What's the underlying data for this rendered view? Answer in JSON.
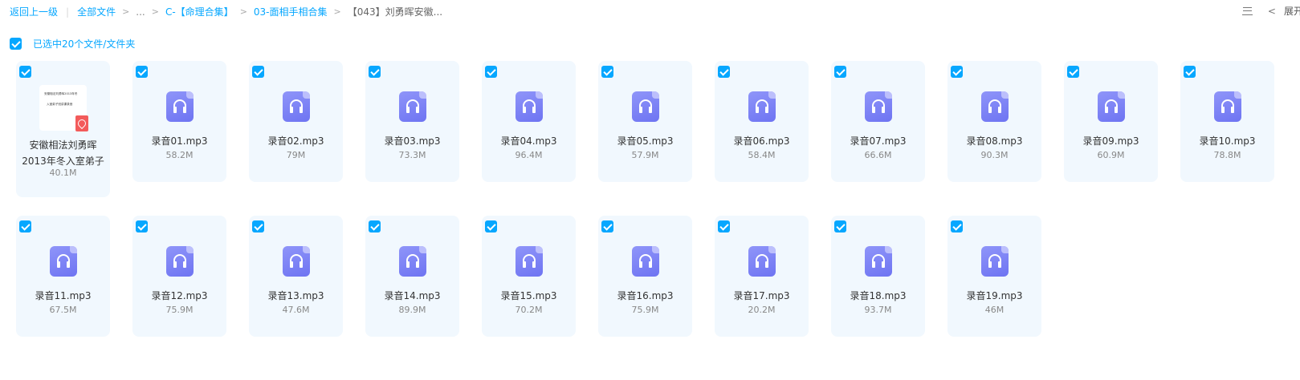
{
  "breadcrumb": {
    "back": "返回上一级",
    "items": [
      "全部文件",
      "...",
      "C-【命理合集】",
      "03-面相手相合集",
      "【043】刘勇晖安徽..."
    ],
    "separator": ">"
  },
  "toolbar": {
    "expand_label": "展开",
    "back_chevron": "<"
  },
  "selection": {
    "label": "已选中20个文件/文件夹"
  },
  "pdf_file": {
    "name": "安徽相法刘勇晖2013年冬入室弟子",
    "size": "40.1M",
    "thumb_line1": "安徽相法刘勇晖2013年冬",
    "thumb_line2": "入室弟子班讲课录音"
  },
  "files_row1": [
    {
      "name": "录音01.mp3",
      "size": "58.2M"
    },
    {
      "name": "录音02.mp3",
      "size": "79M"
    },
    {
      "name": "录音03.mp3",
      "size": "73.3M"
    },
    {
      "name": "录音04.mp3",
      "size": "96.4M"
    },
    {
      "name": "录音05.mp3",
      "size": "57.9M"
    },
    {
      "name": "录音06.mp3",
      "size": "58.4M"
    },
    {
      "name": "录音07.mp3",
      "size": "66.6M"
    },
    {
      "name": "录音08.mp3",
      "size": "90.3M"
    },
    {
      "name": "录音09.mp3",
      "size": "60.9M"
    },
    {
      "name": "录音10.mp3",
      "size": "78.8M"
    }
  ],
  "files_row2": [
    {
      "name": "录音11.mp3",
      "size": "67.5M"
    },
    {
      "name": "录音12.mp3",
      "size": "75.9M"
    },
    {
      "name": "录音13.mp3",
      "size": "47.6M"
    },
    {
      "name": "录音14.mp3",
      "size": "89.9M"
    },
    {
      "name": "录音15.mp3",
      "size": "70.2M"
    },
    {
      "name": "录音16.mp3",
      "size": "75.9M"
    },
    {
      "name": "录音17.mp3",
      "size": "20.2M"
    },
    {
      "name": "录音18.mp3",
      "size": "93.7M"
    },
    {
      "name": "录音19.mp3",
      "size": "46M"
    }
  ],
  "colors": {
    "accent": "#06a7ff",
    "card_bg": "#f1f8fe",
    "audio_icon": "#7b80f5",
    "pdf_badge": "#f35b5b"
  }
}
